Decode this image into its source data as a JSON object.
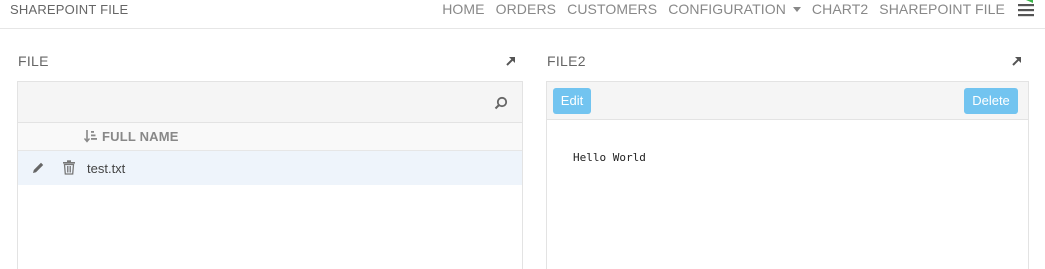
{
  "app": {
    "title": "SHAREPOINT FILE"
  },
  "nav": {
    "items": [
      {
        "label": "HOME"
      },
      {
        "label": "ORDERS"
      },
      {
        "label": "CUSTOMERS"
      },
      {
        "label": "CONFIGURATION"
      },
      {
        "label": "CHART2"
      },
      {
        "label": "SHAREPOINT FILE"
      }
    ],
    "menu_icon": "hamburger-menu-icon"
  },
  "file_panel": {
    "title": "FILE",
    "search_icon": "search-icon",
    "column_header": "FULL NAME",
    "rows": [
      {
        "name": "test.txt"
      }
    ]
  },
  "viewer_panel": {
    "title": "FILE2",
    "edit_label": "Edit",
    "delete_label": "Delete",
    "content": "Hello World"
  },
  "colors": {
    "accent": "#72c4f0",
    "row_selected": "#eef4fb",
    "toolbar_bg": "#f5f5f5"
  }
}
